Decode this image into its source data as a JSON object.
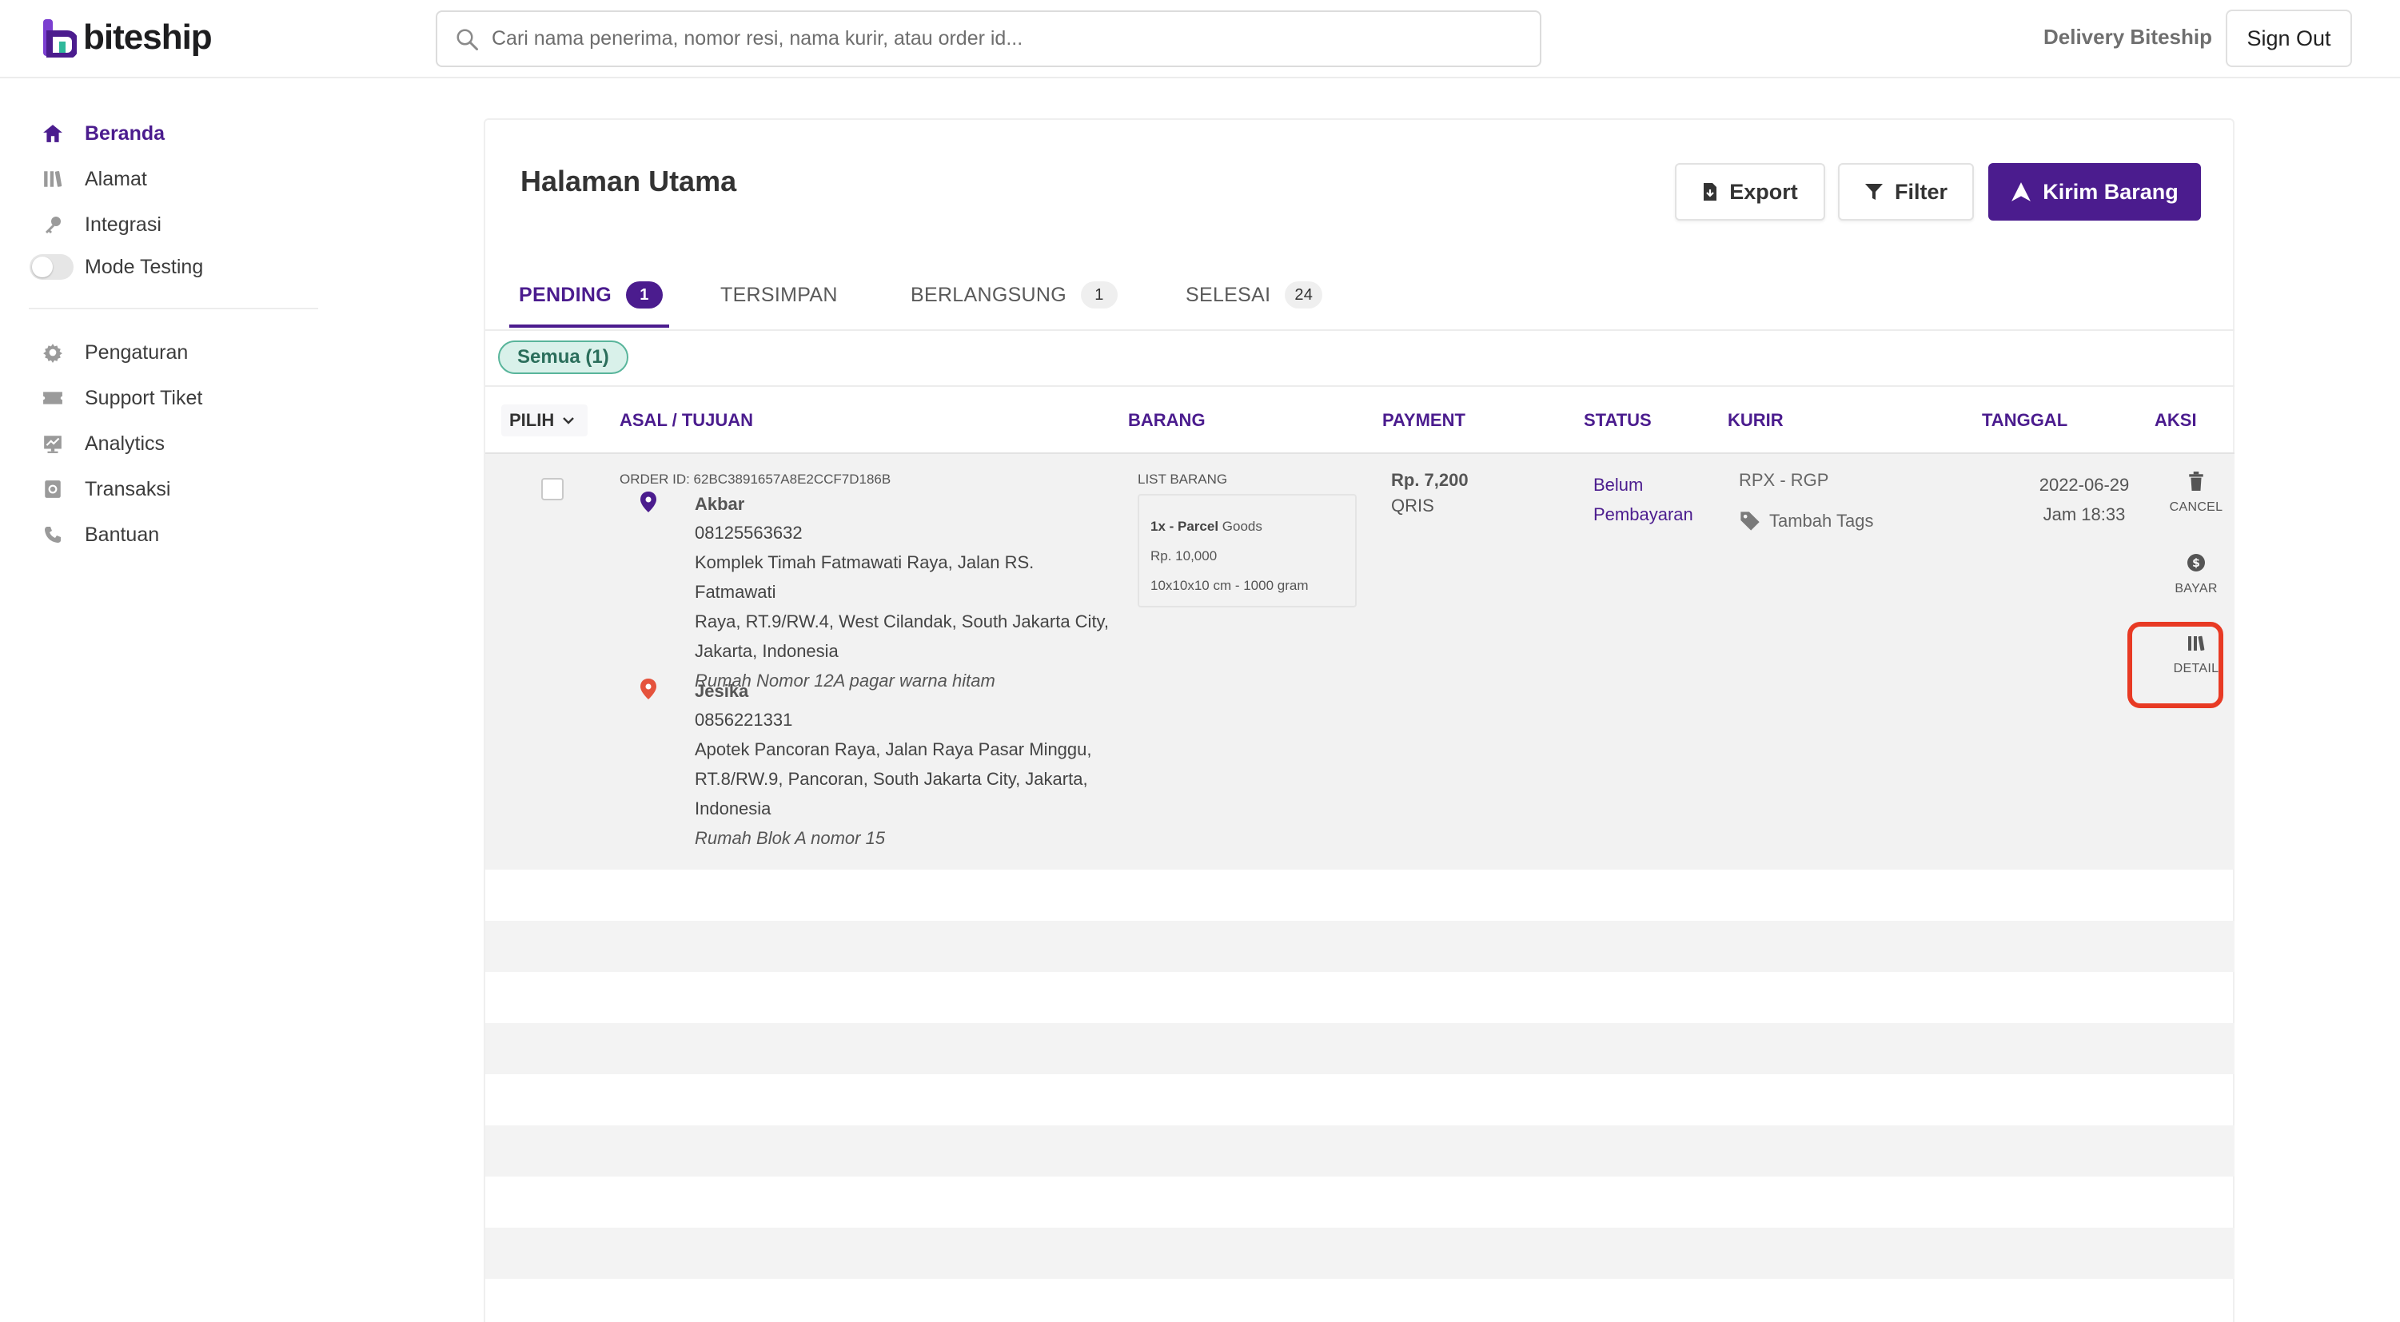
{
  "app": {
    "logo_text": "biteship"
  },
  "search": {
    "placeholder": "Cari nama penerima, nomor resi, nama kurir, atau order id..."
  },
  "header": {
    "delivery_link": "Delivery Biteship",
    "sign_out": "Sign Out"
  },
  "sidebar": {
    "items": [
      {
        "label": "Beranda",
        "icon": "home-icon",
        "active": true
      },
      {
        "label": "Alamat",
        "icon": "book-icon"
      },
      {
        "label": "Integrasi",
        "icon": "key-icon"
      },
      {
        "label": "Mode Testing",
        "icon": "toggle"
      },
      {
        "label": "Pengaturan",
        "icon": "gear-icon"
      },
      {
        "label": "Support Tiket",
        "icon": "ticket-icon"
      },
      {
        "label": "Analytics",
        "icon": "chart-icon"
      },
      {
        "label": "Transaksi",
        "icon": "receipt-icon"
      },
      {
        "label": "Bantuan",
        "icon": "phone-icon"
      }
    ]
  },
  "main": {
    "title": "Halaman Utama",
    "buttons": {
      "export": "Export",
      "filter": "Filter",
      "kirim": "Kirim Barang"
    },
    "tabs": [
      {
        "label": "PENDING",
        "count": "1",
        "active": true
      },
      {
        "label": "TERSIMPAN",
        "count": ""
      },
      {
        "label": "BERLANGSUNG",
        "count": "1"
      },
      {
        "label": "SELESAI",
        "count": "24"
      }
    ],
    "filter_chip": "Semua (1)",
    "columns": {
      "pilih": "PILIH",
      "asal": "ASAL / TUJUAN",
      "barang": "BARANG",
      "payment": "PAYMENT",
      "status": "STATUS",
      "kurir": "KURIR",
      "tanggal": "TANGGAL",
      "aksi": "AKSI"
    },
    "order": {
      "order_id": "ORDER ID: 62BC3891657A8E2CCF7D186B",
      "origin": {
        "name": "Akbar",
        "phone": "08125563632",
        "address_line1": "Komplek Timah Fatmawati Raya, Jalan RS. Fatmawati",
        "address_line2": "Raya, RT.9/RW.4, West Cilandak, South Jakarta City,",
        "address_line3": "Jakarta, Indonesia",
        "note": "Rumah Nomor 12A pagar warna hitam"
      },
      "destination": {
        "name": "Jesika",
        "phone": "0856221331",
        "address_line1": "Apotek Pancoran Raya, Jalan Raya Pasar Minggu,",
        "address_line2": "RT.8/RW.9, Pancoran, South Jakarta City, Jakarta,",
        "address_line3": "Indonesia",
        "note": "Rumah Blok A nomor 15"
      },
      "barang": {
        "title": "LIST BARANG",
        "qty_name": "1x - Parcel",
        "category": "Goods",
        "price": "Rp. 10,000",
        "dimension": "10x10x10 cm - 1000 gram"
      },
      "payment": {
        "amount": "Rp. 7,200",
        "method": "QRIS"
      },
      "status_line1": "Belum",
      "status_line2": "Pembayaran",
      "kurir": "RPX - RGP",
      "tags": "Tambah Tags",
      "date": "2022-06-29",
      "time": "Jam 18:33",
      "actions": {
        "cancel": "CANCEL",
        "bayar": "BAYAR",
        "detail": "DETAIL"
      }
    }
  },
  "colors": {
    "primary": "#4b1c8e",
    "highlight": "#e83a24",
    "chip_bg": "#d9f1ea",
    "chip_border": "#59b59b"
  }
}
